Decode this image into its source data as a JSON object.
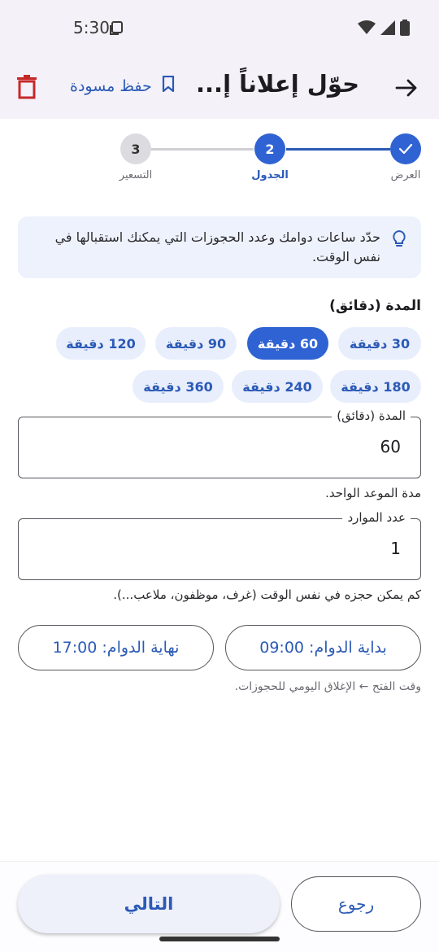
{
  "status_bar": {
    "time": "5:30"
  },
  "app_bar": {
    "title": "حوّل إعلاناً إ...",
    "save_draft": "حفظ مسودة"
  },
  "stepper": {
    "steps": [
      {
        "number": "✓",
        "label": "العرض",
        "state": "done"
      },
      {
        "number": "2",
        "label": "الجدول",
        "state": "active"
      },
      {
        "number": "3",
        "label": "التسعير",
        "state": "pending"
      }
    ]
  },
  "info": {
    "text": "حدّد ساعات دوامك وعدد الحجوزات التي يمكنك استقبالها في نفس الوقت."
  },
  "duration_section": {
    "title": "المدة (دقائق)",
    "chips": [
      {
        "label": "30 دقيقة",
        "selected": false
      },
      {
        "label": "60 دقيقة",
        "selected": true
      },
      {
        "label": "90 دقيقة",
        "selected": false
      },
      {
        "label": "120 دقيقة",
        "selected": false
      },
      {
        "label": "180 دقيقة",
        "selected": false
      },
      {
        "label": "240 دقيقة",
        "selected": false
      },
      {
        "label": "360 دقيقة",
        "selected": false
      }
    ]
  },
  "duration_field": {
    "label": "المدة (دقائق)",
    "value": "60",
    "helper": "مدة الموعد الواحد."
  },
  "resources_field": {
    "label": "عدد الموارد",
    "value": "1",
    "helper": "كم يمكن حجزه في نفس الوقت (غرف، موظفون، ملاعب...)."
  },
  "hours": {
    "start": "بداية الدوام: 09:00",
    "end": "نهاية الدوام: 17:00",
    "hint": "وقت الفتح ← الإغلاق اليومي للحجوزات."
  },
  "footer": {
    "next": "التالي",
    "back": "رجوع"
  },
  "colors": {
    "primary": "#2f63d3",
    "accent_text": "#2b5ab6",
    "delete": "#c62828",
    "chip_bg": "#e8eefc"
  }
}
